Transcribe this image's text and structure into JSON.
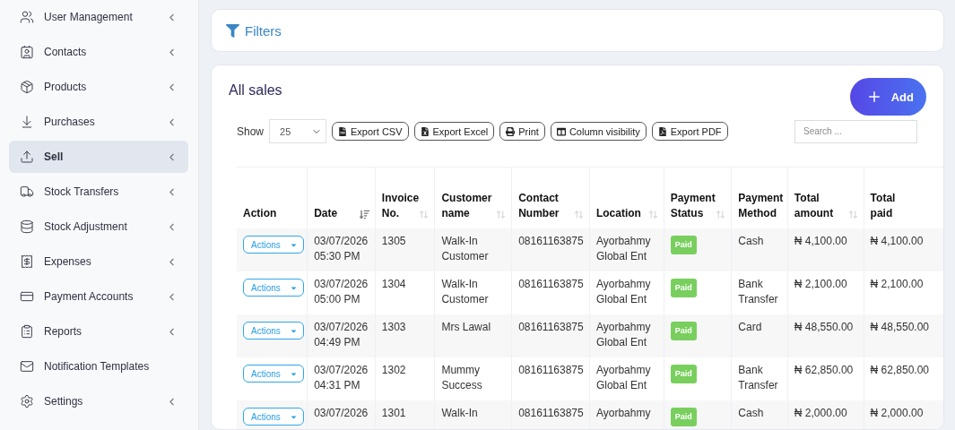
{
  "sidebar": {
    "items": [
      {
        "label": "User Management",
        "selected": false,
        "has_submenu": true
      },
      {
        "label": "Contacts",
        "selected": false,
        "has_submenu": true
      },
      {
        "label": "Products",
        "selected": false,
        "has_submenu": true
      },
      {
        "label": "Purchases",
        "selected": false,
        "has_submenu": true
      },
      {
        "label": "Sell",
        "selected": true,
        "has_submenu": true
      },
      {
        "label": "Stock Transfers",
        "selected": false,
        "has_submenu": true
      },
      {
        "label": "Stock Adjustment",
        "selected": false,
        "has_submenu": true
      },
      {
        "label": "Expenses",
        "selected": false,
        "has_submenu": true
      },
      {
        "label": "Payment Accounts",
        "selected": false,
        "has_submenu": true
      },
      {
        "label": "Reports",
        "selected": false,
        "has_submenu": true
      },
      {
        "label": "Notification Templates",
        "selected": false,
        "has_submenu": false
      },
      {
        "label": "Settings",
        "selected": false,
        "has_submenu": true
      }
    ]
  },
  "filters": {
    "title": "Filters"
  },
  "sales": {
    "title": "All sales",
    "add_button": "Add",
    "show_label": "Show",
    "page_size": "25",
    "export_buttons": [
      "Export CSV",
      "Export Excel",
      "Print",
      "Column visibility",
      "Export PDF"
    ],
    "search": {
      "placeholder": "Search ..."
    },
    "table": {
      "columns": [
        {
          "label": "Action",
          "sortable": false
        },
        {
          "label": "Date",
          "sortable": true,
          "sorted": true
        },
        {
          "label": "Invoice\nNo.",
          "sortable": true,
          "sorted": false
        },
        {
          "label": "Customer\nname",
          "sortable": true,
          "sorted": false
        },
        {
          "label": "Contact\nNumber",
          "sortable": true,
          "sorted": false
        },
        {
          "label": "Location",
          "sortable": true,
          "sorted": false
        },
        {
          "label": "Payment\nStatus",
          "sortable": true,
          "sorted": false
        },
        {
          "label": "Payment\nMethod",
          "sortable": false
        },
        {
          "label": "Total\namount",
          "sortable": true,
          "sorted": false
        },
        {
          "label": "Total\npaid",
          "sortable": false
        }
      ],
      "rows": [
        {
          "action": "Actions",
          "date": "03/07/2026\n05:30 PM",
          "invoice": "1305",
          "customer": "Walk-In\nCustomer",
          "contact": "08161163875",
          "location": "Ayorbahmy\nGlobal Ent",
          "status": "Paid",
          "method": "Cash",
          "total_amount": "₦ 4,100.00",
          "total_paid": "₦ 4,100.00"
        },
        {
          "action": "Actions",
          "date": "03/07/2026\n05:00 PM",
          "invoice": "1304",
          "customer": "Walk-In\nCustomer",
          "contact": "08161163875",
          "location": "Ayorbahmy\nGlobal Ent",
          "status": "Paid",
          "method": "Bank\nTransfer",
          "total_amount": "₦ 2,100.00",
          "total_paid": "₦ 2,100.00"
        },
        {
          "action": "Actions",
          "date": "03/07/2026\n04:49 PM",
          "invoice": "1303",
          "customer": "Mrs Lawal",
          "contact": "08161163875",
          "location": "Ayorbahmy\nGlobal Ent",
          "status": "Paid",
          "method": "Card",
          "total_amount": "₦ 48,550.00",
          "total_paid": "₦ 48,550.00"
        },
        {
          "action": "Actions",
          "date": "03/07/2026\n04:31 PM",
          "invoice": "1302",
          "customer": "Mummy\nSuccess",
          "contact": "08161163875",
          "location": "Ayorbahmy\nGlobal Ent",
          "status": "Paid",
          "method": "Bank\nTransfer",
          "total_amount": "₦ 62,850.00",
          "total_paid": "₦ 62,850.00"
        },
        {
          "action": "Actions",
          "date": "03/07/2026",
          "invoice": "1301",
          "customer": "Walk-In",
          "contact": "08161163875",
          "location": "Ayorbahmy",
          "status": "Paid",
          "method": "Cash",
          "total_amount": "₦ 2,000.00",
          "total_paid": "₦ 2,000.00"
        }
      ]
    }
  }
}
